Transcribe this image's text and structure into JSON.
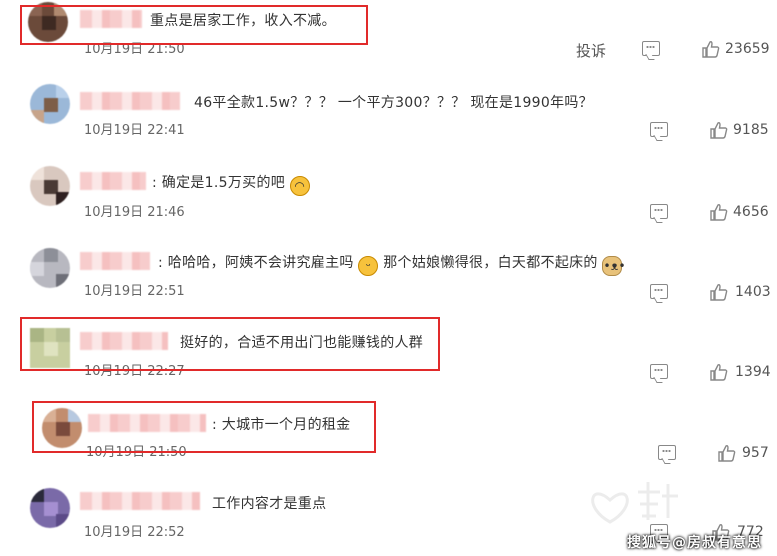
{
  "report_label": "投诉",
  "watermark": "搜狐号@房叔有意思",
  "comments": [
    {
      "text": "重点是居家工作，收入不减。",
      "time": "10月19日 21:50",
      "likes": "23659"
    },
    {
      "text": "46平全款1.5w？？？ 一个平方300？？？ 现在是1990年吗？",
      "time": "10月19日 22:41",
      "likes": "9185"
    },
    {
      "text": "确定是1.5万买的吧",
      "time": "10月19日 21:46",
      "likes": "4656"
    },
    {
      "text_a": "哈哈哈，阿姨不会讲究雇主吗",
      "text_b": "那个姑娘懒得很，白天都不起床的",
      "time": "10月19日 22:51",
      "likes": "1403"
    },
    {
      "text": "挺好的，合适不用出门也能赚钱的人群",
      "time": "10月19日 22:27",
      "likes": "1394"
    },
    {
      "text": "大城市一个月的租金",
      "time": "10月19日 21:50",
      "likes": "957"
    },
    {
      "text": "工作内容才是重点",
      "time": "10月19日 22:52",
      "likes": "772"
    }
  ],
  "colors": {
    "highlight_box": "#e12a2a",
    "name_blur": "#f6c4c4"
  }
}
